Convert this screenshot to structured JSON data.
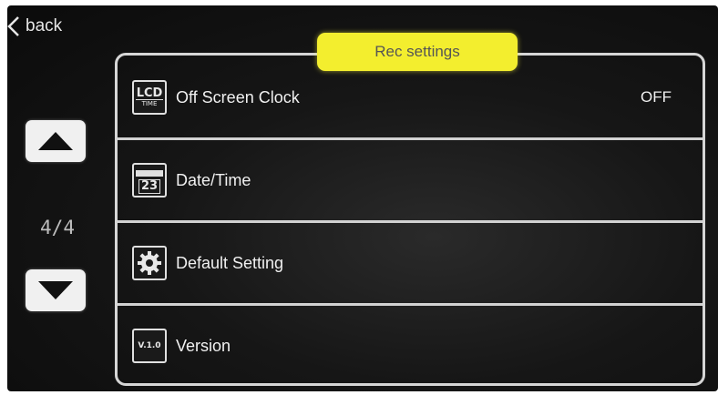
{
  "nav": {
    "back_label": "back"
  },
  "header": {
    "title": "Rec settings"
  },
  "pager": {
    "indicator": "4/4"
  },
  "menu": {
    "items": [
      {
        "icon": "lcd-time-icon",
        "icon_text_top": "LCD",
        "icon_text_bottom": "TIME",
        "label": "Off Screen Clock",
        "value": "OFF"
      },
      {
        "icon": "calendar-icon",
        "icon_text_top": "23",
        "label": "Date/Time"
      },
      {
        "icon": "gear-icon",
        "label": "Default Setting"
      },
      {
        "icon": "version-icon",
        "icon_text_top": "V.1.0",
        "label": "Version"
      }
    ]
  },
  "colors": {
    "accent": "#f3ee2e",
    "background": "#111111",
    "text": "#f0f0f0"
  }
}
